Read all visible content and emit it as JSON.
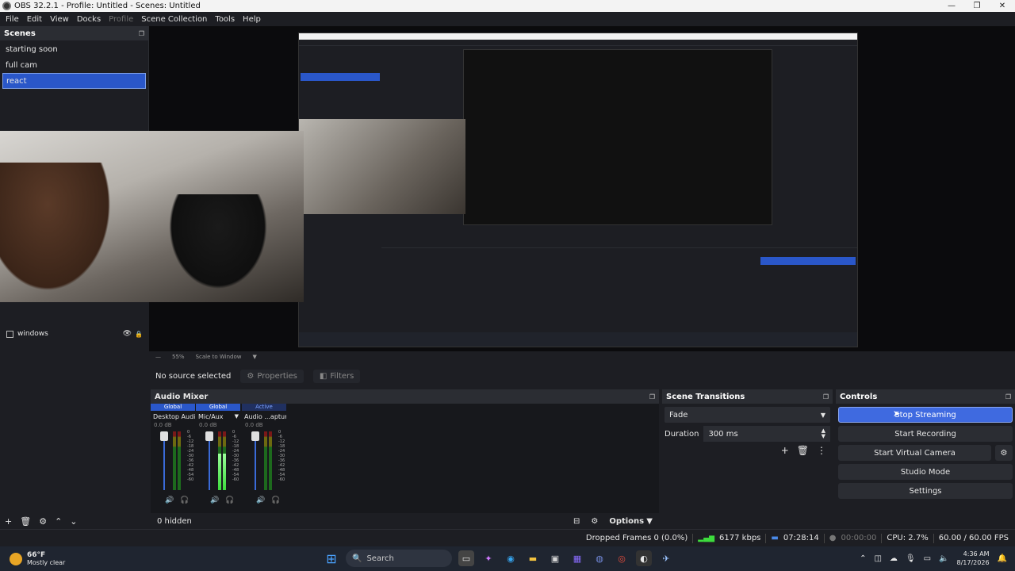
{
  "window": {
    "title": "OBS 32.2.1 - Profile: Untitled - Scenes: Untitled",
    "minimize": "—",
    "maximize": "❐",
    "close": "✕"
  },
  "menu": [
    "File",
    "Edit",
    "View",
    "Docks",
    "Profile",
    "Scene Collection",
    "Tools",
    "Help"
  ],
  "scenes": {
    "title": "Scenes",
    "items": [
      {
        "label": "starting soon",
        "selected": false
      },
      {
        "label": "full cam",
        "selected": false
      },
      {
        "label": "react",
        "selected": true
      }
    ]
  },
  "sources": {
    "items": [
      {
        "label": "windows",
        "visible": true,
        "locked": false
      }
    ]
  },
  "zoom": {
    "value": "55%",
    "mode": "Scale to Window"
  },
  "context": {
    "no_source": "No source selected",
    "properties": "Properties",
    "filters": "Filters"
  },
  "mixer": {
    "title": "Audio Mixer",
    "channels": [
      {
        "badge": "Global",
        "name": "Desktop Audio",
        "db": "0.0 dB",
        "level": 0.0
      },
      {
        "badge": "Global",
        "name": "Mic/Aux",
        "db": "0.0 dB",
        "level": 0.62
      },
      {
        "badge": "Active",
        "name": "Audio ...apture",
        "db": "0.0 dB",
        "level": 0.0
      }
    ],
    "ticks": [
      "0",
      "-6",
      "-12",
      "-18",
      "-24",
      "-30",
      "-36",
      "-42",
      "-48",
      "-54",
      "-60"
    ],
    "hidden": "0 hidden",
    "options": "Options"
  },
  "transitions": {
    "title": "Scene Transitions",
    "selected": "Fade",
    "duration_label": "Duration",
    "duration_value": "300 ms"
  },
  "controls": {
    "title": "Controls",
    "stop_streaming": "Stop Streaming",
    "start_recording": "Start Recording",
    "start_virtual_camera": "Start Virtual Camera",
    "studio_mode": "Studio Mode",
    "settings": "Settings"
  },
  "status": {
    "dropped_frames": "Dropped Frames 0 (0.0%)",
    "bitrate": "6177 kbps",
    "stream_time": "07:28:14",
    "record_time": "00:00:00",
    "cpu": "CPU: 2.7%",
    "fps": "60.00 / 60.00 FPS"
  },
  "taskbar": {
    "temp": "66°F",
    "weather": "Mostly clear",
    "search": "Search",
    "time": "4:36 AM",
    "date": "8/17/2026"
  }
}
